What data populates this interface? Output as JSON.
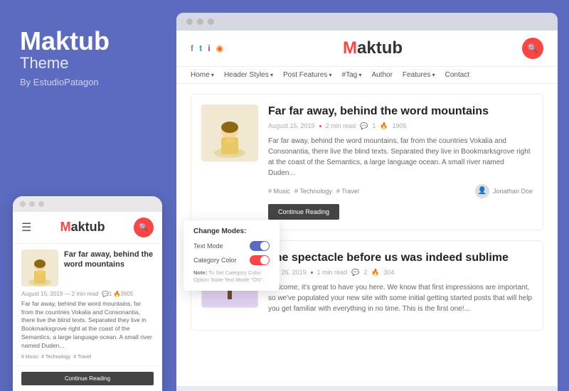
{
  "leftPanel": {
    "brandName": "Maktub",
    "brandSub": "Theme",
    "brandBy": "By EstudioPatagon"
  },
  "mobilePreview": {
    "topDots": [
      "dot1",
      "dot2",
      "dot3"
    ],
    "logo": "Maktub",
    "logoAccent": "M",
    "post": {
      "title": "Far far away, behind the word mountains",
      "meta": "August 15, 2019 — 2 min read",
      "metaComment": "1",
      "metaFire": "3905",
      "excerpt": "Far far away, behind the word mountains, far from the countries Vokalia and Consonantia, there live the blind texts. Separated they live in Bookmarksgrove right at the coast of the Semantics, a large language ocean. A small river named Duden...",
      "tags": [
        "# Music",
        "# Technology",
        "# Travel"
      ],
      "continueBtn": "Continue Reading"
    }
  },
  "desktopPreview": {
    "topDots": [
      "d1",
      "d2",
      "d3"
    ],
    "social": [
      "f",
      "t",
      "in",
      "rss"
    ],
    "logo": "Maktub",
    "logoAccent": "M",
    "nav": [
      {
        "label": "Home",
        "arrow": true
      },
      {
        "label": "Header Styles",
        "arrow": true
      },
      {
        "label": "Post Features",
        "arrow": true
      },
      {
        "label": "#Tag",
        "arrow": true
      },
      {
        "label": "Author",
        "arrow": false
      },
      {
        "label": "Features",
        "arrow": true
      },
      {
        "label": "Contact",
        "arrow": false
      }
    ],
    "posts": [
      {
        "id": "post1",
        "title": "Far far away, behind the word mountains",
        "date": "August 15, 2019",
        "readTime": "2 min read",
        "comments": "1",
        "views": "1905",
        "excerpt": "Far far away, behind the word mountains, far from the countries Vokalia and Consonantia, there live the blind texts. Separated they live in Bookmarksgrove right at the coast of the Semantics, a large language ocean. A small river named Duden...",
        "tags": [
          "# Music",
          "# Technology",
          "# Travel"
        ],
        "author": "Jonathan Doe",
        "continueBtn": "Continue Reading",
        "thumbType": "person"
      },
      {
        "id": "post2",
        "title": "The spectacle before us was indeed sublime",
        "date": "July 26, 2019",
        "readTime": "1 min read",
        "comments": "2",
        "views": "304",
        "excerpt": "Welcome, it's great to have you here. We know that first impressions are important, so we've populated your new site with some initial getting started posts that will help you get familiar with everything in no time. This is the first one!...",
        "tags": [],
        "thumbType": "tree"
      }
    ]
  },
  "popup": {
    "title": "Change Modes:",
    "row1Label": "Text Mode",
    "row2Label": "Category Color",
    "note": "Note: To Set Category Color Option State Text Mode \"ON\".",
    "noteLabel": "Note:"
  },
  "floatingPen": "✏"
}
